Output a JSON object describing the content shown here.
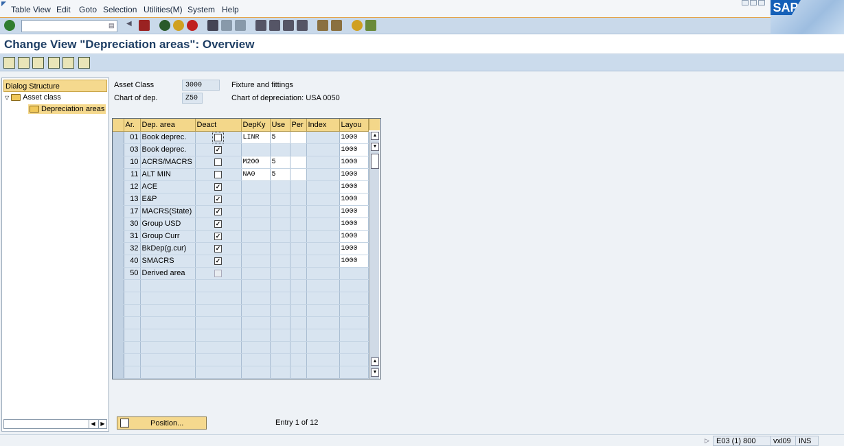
{
  "menu": {
    "items": [
      "Table View",
      "Edit",
      "Goto",
      "Selection",
      "Utilities(M)",
      "System",
      "Help"
    ],
    "underline": [
      "T",
      "E",
      "G",
      "S",
      "U",
      "S",
      "H"
    ]
  },
  "toolbar": {
    "command_field": ""
  },
  "title": "Change View \"Depreciation areas\": Overview",
  "dialog_structure": {
    "header": "Dialog Structure",
    "node1": "Asset class",
    "node2": "Depreciation areas"
  },
  "fields": {
    "asset_class_label": "Asset Class",
    "asset_class_value": "3000",
    "asset_class_desc": "Fixture and fittings",
    "chart_label": "Chart of dep.",
    "chart_value": "Z50",
    "chart_desc": "Chart of depreciation: USA 0050"
  },
  "table": {
    "headers": [
      "Ar.",
      "Dep. area",
      "Deact",
      "DepKy",
      "Use",
      "Per",
      "Index",
      "Layou"
    ],
    "rows": [
      {
        "ar": "01",
        "area": "Book deprec.",
        "deact": false,
        "depky": "LINR",
        "use": "5",
        "per": "",
        "index": "",
        "layout": "1000",
        "editable": true
      },
      {
        "ar": "03",
        "area": "Book deprec.",
        "deact": true,
        "depky": "",
        "use": "",
        "per": "",
        "index": "",
        "layout": "1000",
        "editable": false
      },
      {
        "ar": "10",
        "area": "ACRS/MACRS",
        "deact": false,
        "depky": "M200",
        "use": "5",
        "per": "",
        "index": "",
        "layout": "1000",
        "editable": true
      },
      {
        "ar": "11",
        "area": "ALT MIN",
        "deact": false,
        "depky": "NA0",
        "use": "5",
        "per": "",
        "index": "",
        "layout": "1000",
        "editable": true
      },
      {
        "ar": "12",
        "area": "ACE",
        "deact": true,
        "depky": "",
        "use": "",
        "per": "",
        "index": "",
        "layout": "1000",
        "editable": false
      },
      {
        "ar": "13",
        "area": "E&P",
        "deact": true,
        "depky": "",
        "use": "",
        "per": "",
        "index": "",
        "layout": "1000",
        "editable": false
      },
      {
        "ar": "17",
        "area": "MACRS(State)",
        "deact": true,
        "depky": "",
        "use": "",
        "per": "",
        "index": "",
        "layout": "1000",
        "editable": false
      },
      {
        "ar": "30",
        "area": "Group USD",
        "deact": true,
        "depky": "",
        "use": "",
        "per": "",
        "index": "",
        "layout": "1000",
        "editable": false
      },
      {
        "ar": "31",
        "area": "Group Curr",
        "deact": true,
        "depky": "",
        "use": "",
        "per": "",
        "index": "",
        "layout": "1000",
        "editable": false
      },
      {
        "ar": "32",
        "area": "BkDep(g.cur)",
        "deact": true,
        "depky": "",
        "use": "",
        "per": "",
        "index": "",
        "layout": "1000",
        "editable": false
      },
      {
        "ar": "40",
        "area": "SMACRS",
        "deact": true,
        "depky": "",
        "use": "",
        "per": "",
        "index": "",
        "layout": "1000",
        "editable": false
      },
      {
        "ar": "50",
        "area": "Derived area",
        "deact": "disabled",
        "depky": "",
        "use": "",
        "per": "",
        "index": "",
        "layout": "",
        "editable": false
      }
    ],
    "empty_rows": 8
  },
  "position_button": "Position...",
  "entry_info": "Entry 1 of 12",
  "status": {
    "system": "E03 (1) 800",
    "server": "vxl09",
    "mode": "INS"
  },
  "sap_logo": "SAP"
}
